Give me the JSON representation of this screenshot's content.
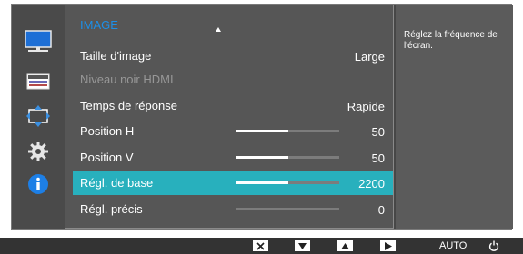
{
  "side_menu": {
    "items": [
      {
        "icon": "monitor-icon",
        "selected": true
      },
      {
        "icon": "onscreen-display-icon",
        "selected": false
      },
      {
        "icon": "size-position-icon",
        "selected": false
      },
      {
        "icon": "gear-icon",
        "selected": false
      },
      {
        "icon": "info-icon",
        "selected": false
      }
    ]
  },
  "menu": {
    "title": "IMAGE",
    "items": [
      {
        "label": "Taille d'image",
        "value": "Large",
        "disabled": false,
        "selected": false
      },
      {
        "label": "Niveau noir HDMI",
        "value": "",
        "disabled": true,
        "selected": false
      },
      {
        "label": "Temps de réponse",
        "value": "Rapide",
        "disabled": false,
        "selected": false
      },
      {
        "label": "Position H",
        "value": "50",
        "slider": 0.5,
        "disabled": false,
        "selected": false
      },
      {
        "label": "Position V",
        "value": "50",
        "slider": 0.5,
        "disabled": false,
        "selected": false
      },
      {
        "label": "Régl. de base",
        "value": "2200",
        "slider": 0.5,
        "disabled": false,
        "selected": true
      },
      {
        "label": "Régl. précis",
        "value": "0",
        "slider": 0.0,
        "disabled": false,
        "selected": false
      }
    ]
  },
  "help": {
    "text": "Réglez la fréquence de l'écran."
  },
  "bottom_bar": {
    "keys": [
      "close-icon",
      "down-arrow-icon",
      "up-arrow-icon",
      "enter-icon"
    ],
    "auto_label": "AUTO",
    "power_icon": "power-icon"
  },
  "colors": {
    "accent_title": "#1c8fe8",
    "selected_row": "#28b0bd",
    "panel": "#565656"
  }
}
